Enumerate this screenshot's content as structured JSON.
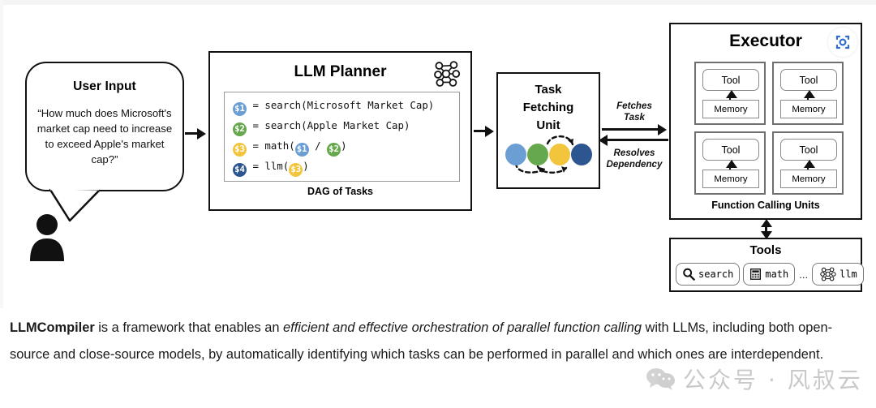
{
  "diagram": {
    "user_input": {
      "title": "User Input",
      "quote": "“How much does Microsoft's market cap need to increase to exceed Apple's market cap?”",
      "person_icon": "person-icon"
    },
    "planner": {
      "title": "LLM Planner",
      "icon": "neural-network-icon",
      "footer_label": "DAG of Tasks",
      "code_lines": [
        {
          "var": "$1",
          "var_color": "#6b9fd4",
          "text": " = search(Microsoft Market Cap)"
        },
        {
          "var": "$2",
          "var_color": "#66a84e",
          "text": " = search(Apple Market Cap)"
        },
        {
          "var": "$3",
          "var_color": "#f2c53d",
          "text": " = math(",
          "args": [
            "$1",
            " / ",
            "$2"
          ],
          "tail": ")"
        },
        {
          "var": "$4",
          "var_color": "#2d558f",
          "text": " = llm(",
          "args": [
            "$3"
          ],
          "tail": ")"
        }
      ]
    },
    "task_fetching_unit": {
      "title_lines": [
        "Task",
        "Fetching",
        "Unit"
      ],
      "dots": [
        {
          "label": "task-1-dot",
          "color": "#6b9fd4"
        },
        {
          "label": "task-2-dot",
          "color": "#66a84e"
        },
        {
          "label": "task-3-dot",
          "color": "#f2c53d"
        },
        {
          "label": "task-4-dot",
          "color": "#2d558f"
        }
      ]
    },
    "executor": {
      "title": "Executor",
      "badge_icon": "scan-focus-icon",
      "footer_label": "Function Calling Units",
      "units": [
        {
          "tool": "Tool",
          "memory": "Memory"
        },
        {
          "tool": "Tool",
          "memory": "Memory"
        },
        {
          "tool": "Tool",
          "memory": "Memory"
        },
        {
          "tool": "Tool",
          "memory": "Memory"
        }
      ]
    },
    "tools": {
      "title": "Tools",
      "chips": [
        {
          "label": "search",
          "icon": "search-icon"
        },
        {
          "label": "math",
          "icon": "calculator-icon"
        },
        {
          "label": "llm",
          "icon": "neural-network-icon"
        }
      ],
      "ellipsis": "..."
    },
    "arrows": {
      "fetches_task": "Fetches\nTask",
      "fetches_task_line1": "Fetches",
      "fetches_task_line2": "Task",
      "resolves_dependency_line1": "Resolves",
      "resolves_dependency_line2": "Dependency"
    }
  },
  "caption": {
    "part1_bold": "LLMCompiler",
    "part2": " is a framework that enables an ",
    "part3_italic": "efficient and effective orchestration of parallel function calling",
    "part4": " with LLMs, including both open-source and close-source models, by automatically identifying which tasks can be performed in parallel and which ones are interdependent."
  },
  "watermark": {
    "text": "公众号 · 风叔云",
    "icon": "wechat-icon"
  },
  "colors": {
    "task1_blue": "#6b9fd4",
    "task2_green": "#66a84e",
    "task3_gold": "#f2c53d",
    "task4_navy": "#2d558f",
    "badge_blue": "#2f6fd0",
    "outline": "#111111"
  }
}
